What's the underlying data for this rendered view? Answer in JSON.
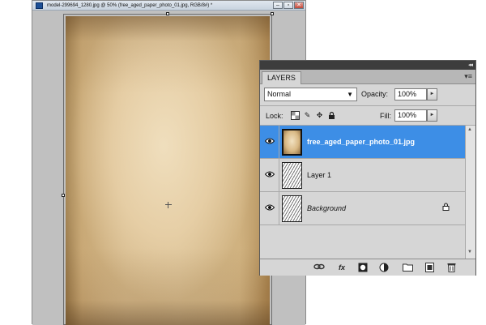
{
  "document": {
    "title": "model-299694_1280.jpg @ 50% (free_aged_paper_photo_01.jpg, RGB/8#) *",
    "window_buttons": {
      "minimize": "–",
      "restore": "▫",
      "close": "✕"
    }
  },
  "layers_panel": {
    "collapse_glyph": "◂◂",
    "tab_label": "LAYERS",
    "menu_glyph": "▾≡",
    "blend_mode": "Normal",
    "opacity_label": "Opacity:",
    "opacity_value": "100%",
    "lock_label": "Lock:",
    "fill_label": "Fill:",
    "fill_value": "100%",
    "stepper_glyph": "►",
    "layers": [
      {
        "name": "free_aged_paper_photo_01.jpg",
        "selected": true,
        "visible": true
      },
      {
        "name": "Layer 1",
        "selected": false,
        "visible": true
      },
      {
        "name": "Background",
        "selected": false,
        "visible": true,
        "locked": true
      }
    ],
    "footer_icons": [
      "link-layers-icon",
      "fx-icon",
      "add-mask-icon",
      "adjustment-layer-icon",
      "new-group-icon",
      "new-layer-icon",
      "trash-icon"
    ]
  },
  "colors": {
    "selection": "#3d8ee6",
    "panel_bg": "#d6d6d6",
    "panel_header": "#3d3d3d",
    "canvas_bg": "#c0c0c0"
  }
}
